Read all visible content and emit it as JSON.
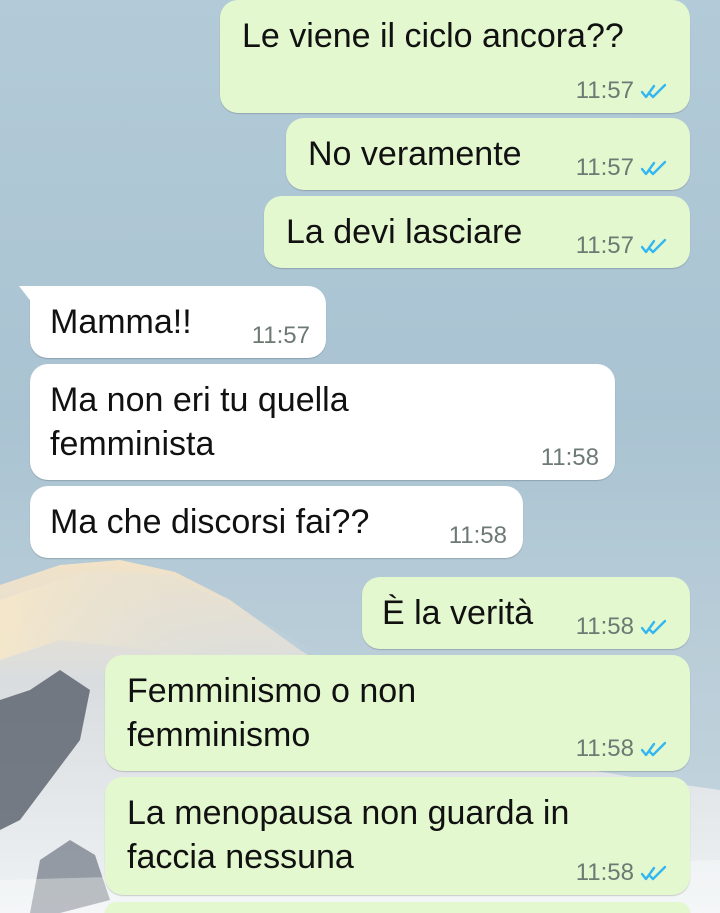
{
  "colors": {
    "outgoing_bubble": "#e4f8d0",
    "incoming_bubble": "#ffffff",
    "read_tick": "#34b7f1",
    "time_text": "#6d7a73"
  },
  "messages": [
    {
      "direction": "outgoing",
      "text": "Le viene il ciclo ancora??",
      "time": "11:57",
      "status": "read-double-check-icon"
    },
    {
      "direction": "outgoing",
      "text": "No veramente",
      "time": "11:57",
      "status": "read-double-check-icon"
    },
    {
      "direction": "outgoing",
      "text": "La devi lasciare",
      "time": "11:57",
      "status": "read-double-check-icon"
    },
    {
      "direction": "incoming",
      "text": "Mamma!!",
      "time": "11:57"
    },
    {
      "direction": "incoming",
      "text": "Ma non eri tu quella\nfemminista",
      "time": "11:58"
    },
    {
      "direction": "incoming",
      "text": "Ma che discorsi fai??",
      "time": "11:58"
    },
    {
      "direction": "outgoing",
      "text": "È la verità",
      "time": "11:58",
      "status": "read-double-check-icon"
    },
    {
      "direction": "outgoing",
      "text": "Femminismo o non\nfemminismo",
      "time": "11:58",
      "status": "read-double-check-icon"
    },
    {
      "direction": "outgoing",
      "text": "La menopausa non guarda in\nfaccia nessuna",
      "time": "11:58",
      "status": "read-double-check-icon"
    }
  ]
}
